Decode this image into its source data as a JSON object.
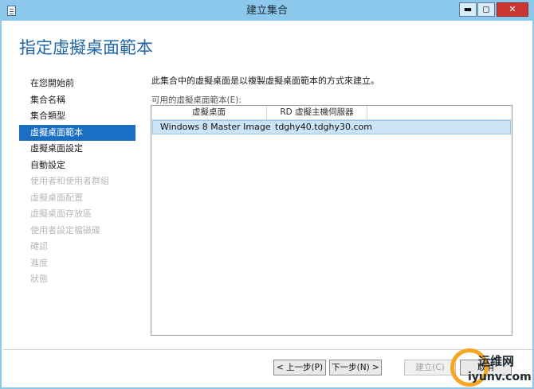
{
  "window": {
    "title": "建立集合",
    "controls": {
      "minimize": "▬",
      "maximize": "◻",
      "close": "✕"
    }
  },
  "page": {
    "heading": "指定虛擬桌面範本"
  },
  "nav": {
    "items": [
      {
        "label": "在您開始前",
        "state": "normal"
      },
      {
        "label": "集合名稱",
        "state": "normal"
      },
      {
        "label": "集合類型",
        "state": "normal"
      },
      {
        "label": "虛擬桌面範本",
        "state": "active"
      },
      {
        "label": "虛擬桌面設定",
        "state": "normal"
      },
      {
        "label": "自動設定",
        "state": "normal"
      },
      {
        "label": "使用者和使用者群組",
        "state": "disabled"
      },
      {
        "label": "虛擬桌面配置",
        "state": "disabled"
      },
      {
        "label": "虛擬桌面存放區",
        "state": "disabled"
      },
      {
        "label": "使用者設定檔磁碟",
        "state": "disabled"
      },
      {
        "label": "確認",
        "state": "disabled"
      },
      {
        "label": "進度",
        "state": "disabled"
      },
      {
        "label": "狀態",
        "state": "disabled"
      }
    ]
  },
  "content": {
    "description": "此集合中的虛擬桌面是以複製虛擬桌面範本的方式來建立。",
    "list_label": "可用的虛擬桌面範本(E):",
    "columns": [
      "虛擬桌面",
      "RD 虛擬主機伺服器"
    ],
    "rows": [
      {
        "desktop": "Windows 8 Master Image",
        "host": "tdghy40.tdghy30.com",
        "selected": true
      }
    ]
  },
  "buttons": {
    "previous": "< 上一步(P)",
    "next": "下一步(N) >",
    "create": "建立(C)",
    "cancel": "取消"
  },
  "watermark": {
    "line1": "运维网",
    "line2": "iyunv.com"
  },
  "colors": {
    "titlebar": "#8cc8ec",
    "accent": "#2166a7",
    "nav_active": "#1a6fc4",
    "row_selected": "#cce4f7"
  }
}
